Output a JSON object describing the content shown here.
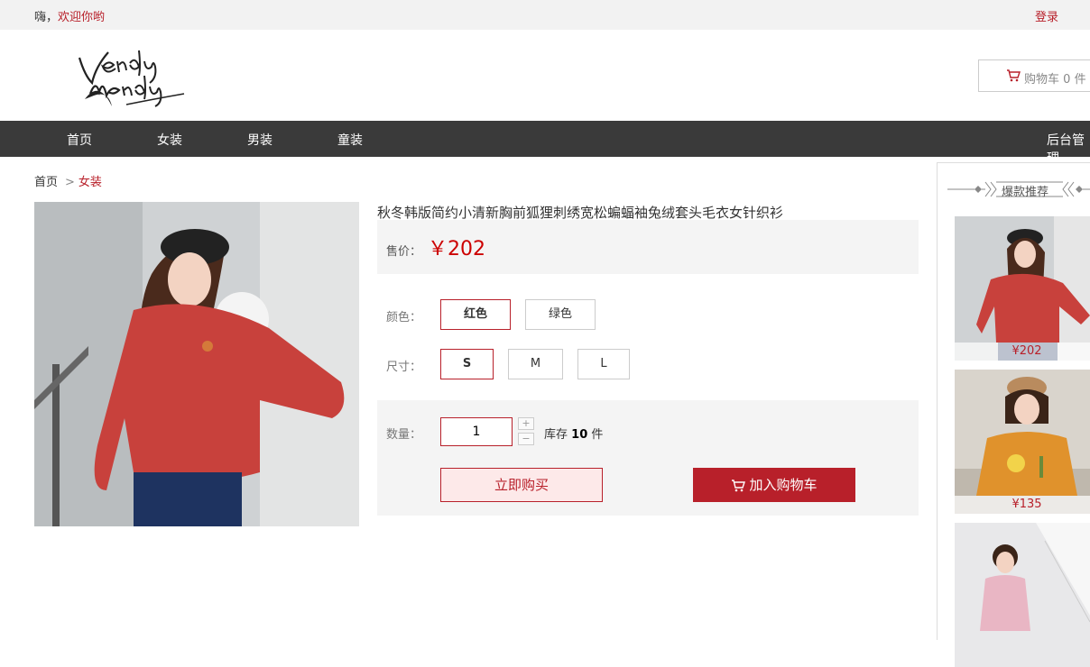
{
  "topbar": {
    "greeting": "嗨，",
    "welcome": "欢迎你哟",
    "login": "登录"
  },
  "logo": {
    "alt": "Vendy Mendy"
  },
  "cart": {
    "label": "购物车",
    "count": "0",
    "unit": "件"
  },
  "nav": {
    "items": [
      "首页",
      "女装",
      "男装",
      "童装"
    ],
    "admin": "后台管理"
  },
  "breadcrumb": {
    "home": "首页",
    "sep": ">",
    "current": "女装"
  },
  "product": {
    "title": "秋冬韩版简约小清新胸前狐狸刺绣宽松蝙蝠袖兔绒套头毛衣女针织衫",
    "price_label": "售价：",
    "price": "￥202",
    "color_label": "颜色：",
    "colors": [
      "红色",
      "绿色"
    ],
    "selected_color": "红色",
    "size_label": "尺寸：",
    "sizes": [
      "S",
      "M",
      "L"
    ],
    "selected_size": "S",
    "qty_label": "数量：",
    "qty": "1",
    "stock_prefix": "库存",
    "stock": "10",
    "stock_unit": "件",
    "buy_now": "立即购买",
    "add_cart": "加入购物车"
  },
  "sidebar": {
    "title": "爆款推荐",
    "items": [
      {
        "price": "¥202"
      },
      {
        "price": "¥135"
      },
      {
        "price": ""
      }
    ]
  },
  "colors": {
    "accent": "#b8202a",
    "nav_bg": "#3a3a3a",
    "panel_bg": "#f4f4f4"
  },
  "icons": {
    "cart": "cart-icon"
  }
}
